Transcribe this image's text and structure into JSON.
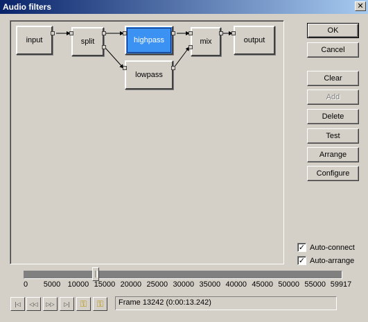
{
  "window": {
    "title": "Audio filters",
    "close_glyph": "✕"
  },
  "graph": {
    "nodes": [
      {
        "id": "input",
        "label": "input",
        "selected": false
      },
      {
        "id": "split",
        "label": "split",
        "selected": false
      },
      {
        "id": "highpass",
        "label": "highpass",
        "selected": true
      },
      {
        "id": "mix",
        "label": "mix",
        "selected": false
      },
      {
        "id": "output",
        "label": "output",
        "selected": false
      },
      {
        "id": "lowpass",
        "label": "lowpass",
        "selected": false
      }
    ],
    "connections": [
      [
        "input",
        "split"
      ],
      [
        "split",
        "highpass"
      ],
      [
        "split",
        "lowpass"
      ],
      [
        "highpass",
        "mix"
      ],
      [
        "lowpass",
        "mix"
      ],
      [
        "mix",
        "output"
      ]
    ],
    "selected_color": "#3c92f2"
  },
  "buttons": {
    "ok": "OK",
    "cancel": "Cancel",
    "clear": "Clear",
    "add": "Add",
    "delete": "Delete",
    "test": "Test",
    "arrange": "Arrange",
    "configure": "Configure"
  },
  "options": {
    "auto_connect": {
      "label": "Auto-connect",
      "checked": true
    },
    "auto_arrange": {
      "label": "Auto-arrange",
      "checked": true
    },
    "check_glyph": "✓"
  },
  "timeline": {
    "min": 0,
    "max": 59917,
    "position": 13242,
    "tick_labels": [
      "0",
      "5000",
      "10000",
      "15000",
      "20000",
      "25000",
      "30000",
      "35000",
      "40000",
      "45000",
      "50000",
      "55000",
      "59917"
    ],
    "frame_text": "Frame 13242 (0:00:13.242)"
  },
  "transport": [
    {
      "name": "go-to-start-icon",
      "glyph": "|◁"
    },
    {
      "name": "step-back-icon",
      "glyph": "◁◁"
    },
    {
      "name": "step-forward-icon",
      "glyph": "▷▷"
    },
    {
      "name": "go-to-end-icon",
      "glyph": "▷|"
    },
    {
      "name": "key-previous-icon",
      "glyph": "⚿"
    },
    {
      "name": "key-next-icon",
      "glyph": "⚿"
    }
  ]
}
